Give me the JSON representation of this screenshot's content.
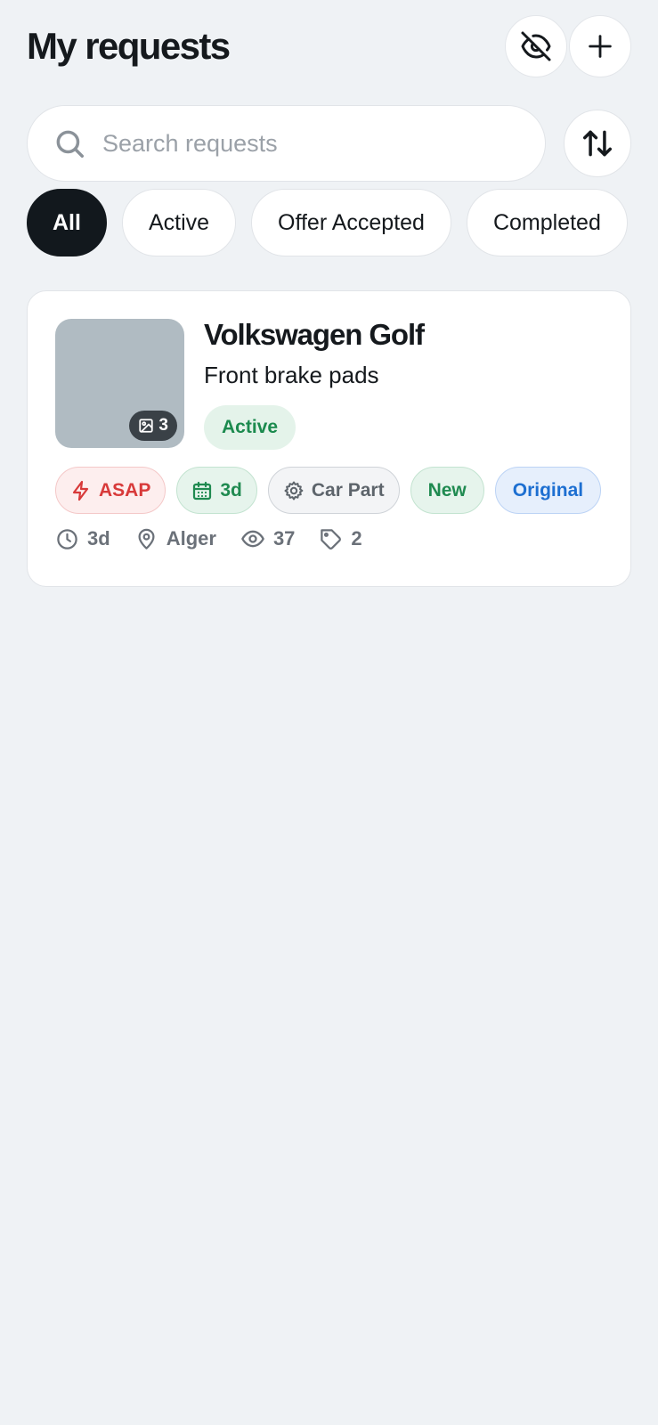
{
  "header": {
    "title": "My requests",
    "hide_icon": "eye-off-icon",
    "add_icon": "plus-icon"
  },
  "search": {
    "placeholder": "Search requests",
    "value": "",
    "icon": "search-icon"
  },
  "sort": {
    "icon": "arrows-up-down-icon"
  },
  "filters": {
    "selected": "All",
    "items": [
      {
        "label": "All"
      },
      {
        "label": "Active"
      },
      {
        "label": "Offer Accepted"
      },
      {
        "label": "Completed"
      }
    ]
  },
  "requests": [
    {
      "title": "Volkswagen Golf",
      "part": "Front brake pads",
      "status": "Active",
      "image_count": "3",
      "tags": {
        "urgency": "ASAP",
        "deadline": "3d",
        "category": "Car Part",
        "condition": "New",
        "origin": "Original"
      },
      "meta": {
        "age": "3d",
        "location": "Alger",
        "views": "37",
        "offers": "2"
      }
    }
  ],
  "colors": {
    "background": "#eff2f5",
    "selected_chip": "#12181d",
    "status_active_bg": "#e4f3ea",
    "status_active_text": "#1b8a4e",
    "urgent": "#d83a3a",
    "original": "#1d6fd1"
  }
}
